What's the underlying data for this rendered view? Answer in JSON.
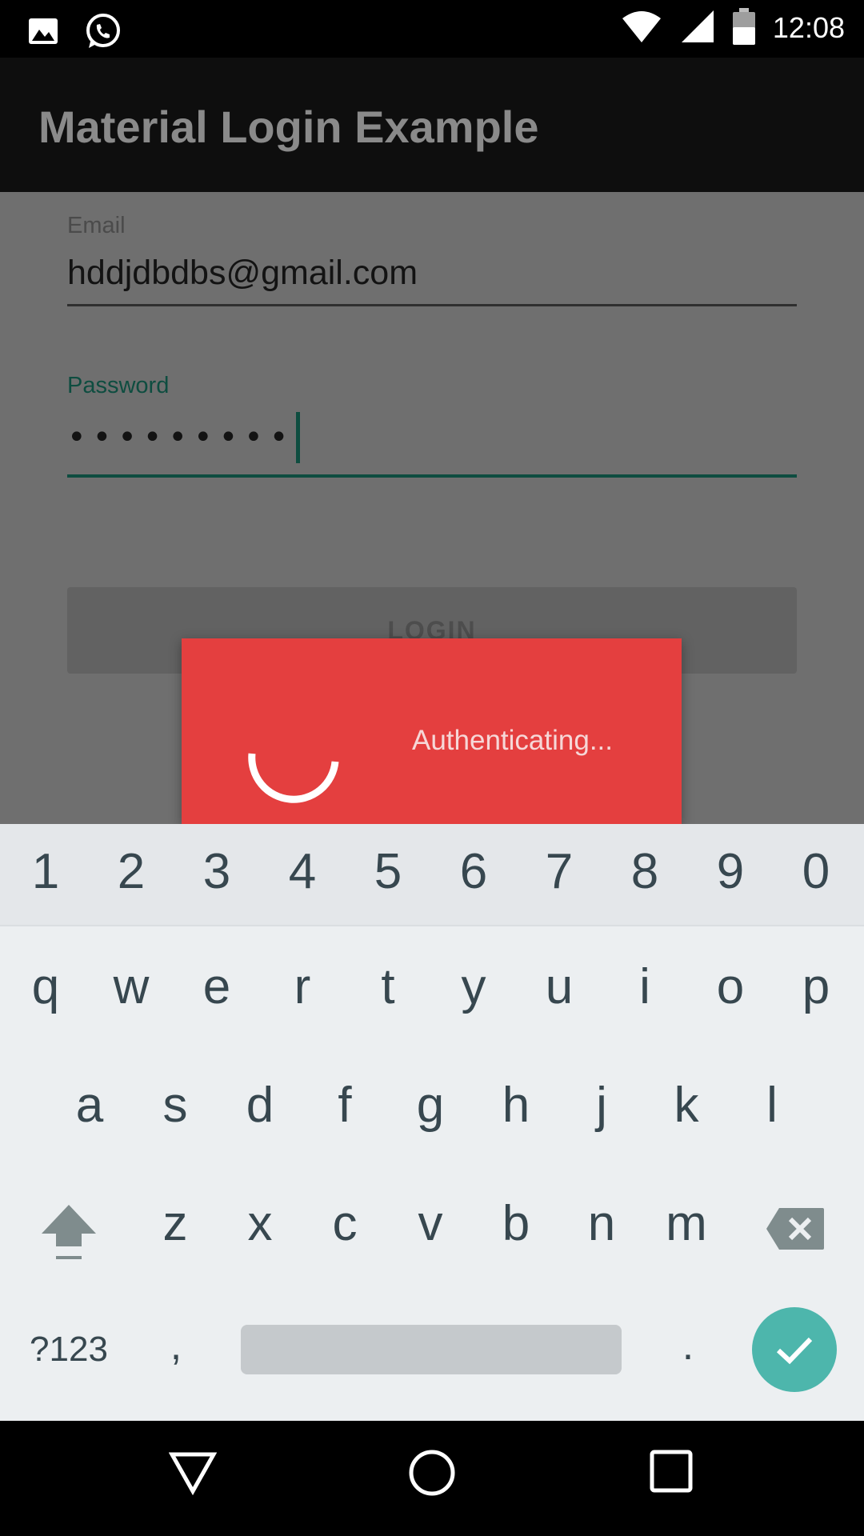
{
  "status_bar": {
    "time": "12:08",
    "left_icons": [
      "image-icon",
      "whatsapp-icon"
    ],
    "right_icons": [
      "wifi-icon",
      "signal-icon",
      "battery-icon"
    ]
  },
  "app_bar": {
    "title": "Material Login Example"
  },
  "form": {
    "email_label": "Email",
    "email_value": "hddjdbdbs@gmail.com",
    "password_label": "Password",
    "password_value": "•••••••••",
    "login_label": "LOGIN"
  },
  "dialog": {
    "message": "Authenticating..."
  },
  "keyboard": {
    "numbers": [
      "1",
      "2",
      "3",
      "4",
      "5",
      "6",
      "7",
      "8",
      "9",
      "0"
    ],
    "row1": [
      "q",
      "w",
      "e",
      "r",
      "t",
      "y",
      "u",
      "i",
      "o",
      "p"
    ],
    "row2": [
      "a",
      "s",
      "d",
      "f",
      "g",
      "h",
      "j",
      "k",
      "l"
    ],
    "row3": [
      "z",
      "x",
      "c",
      "v",
      "b",
      "n",
      "m"
    ],
    "symbols_key": "?123",
    "comma_key": ",",
    "period_key": "."
  },
  "nav_bar": {
    "buttons": [
      "back-icon",
      "home-icon",
      "recents-icon"
    ]
  },
  "colors": {
    "accent": "#0e4d40",
    "dialog": "#e43f3f",
    "enter_key": "#4db6ac"
  }
}
